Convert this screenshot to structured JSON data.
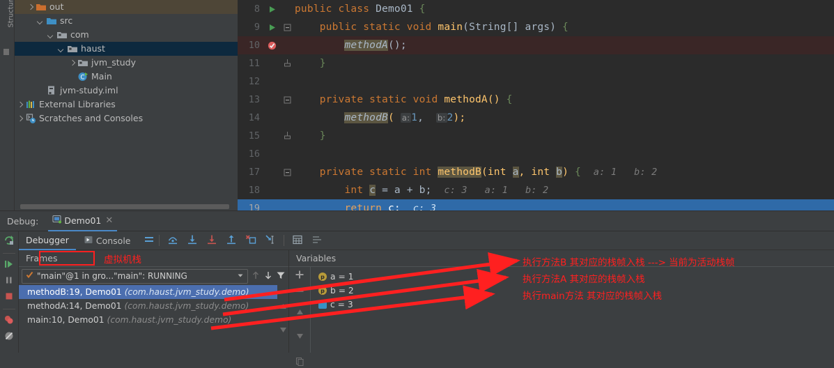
{
  "structure_tab": "Structure",
  "project_tree": {
    "items": [
      {
        "label": "out",
        "icon": "folder-orange-icon",
        "depth": 2,
        "arrow": "right",
        "state": "brown"
      },
      {
        "label": "src",
        "icon": "folder-blue-icon",
        "depth": 3,
        "arrow": "down",
        "state": "none"
      },
      {
        "label": "com",
        "icon": "package-icon",
        "depth": 4,
        "arrow": "down",
        "state": "none"
      },
      {
        "label": "haust",
        "icon": "package-icon",
        "depth": 5,
        "arrow": "down",
        "state": "selected"
      },
      {
        "label": "jvm_study",
        "icon": "package-icon",
        "depth": 6,
        "arrow": "right",
        "state": "none"
      },
      {
        "label": "Main",
        "icon": "java-class-run-icon",
        "depth": 6,
        "arrow": "none",
        "state": "none"
      },
      {
        "label": "jvm-study.iml",
        "icon": "iml-file-icon",
        "depth": 3,
        "arrow": "none",
        "state": "none"
      },
      {
        "label": "External Libraries",
        "icon": "libraries-icon",
        "depth": 1,
        "arrow": "right",
        "state": "none"
      },
      {
        "label": "Scratches and Consoles",
        "icon": "scratches-icon",
        "depth": 1,
        "arrow": "right",
        "state": "none"
      }
    ]
  },
  "editor": {
    "lines": [
      {
        "num": "8",
        "gutter": "run-green-icon",
        "fold": "none",
        "state": "normal"
      },
      {
        "num": "9",
        "gutter": "run-green-icon",
        "fold": "minus",
        "state": "normal"
      },
      {
        "num": "10",
        "gutter": "breakpoint-done-icon",
        "fold": "none",
        "state": "breakpoint"
      },
      {
        "num": "11",
        "gutter": "none",
        "fold": "end",
        "state": "normal"
      },
      {
        "num": "12",
        "gutter": "none",
        "fold": "none",
        "state": "normal"
      },
      {
        "num": "13",
        "gutter": "none",
        "fold": "minus",
        "state": "normal"
      },
      {
        "num": "14",
        "gutter": "none",
        "fold": "none",
        "state": "normal"
      },
      {
        "num": "15",
        "gutter": "none",
        "fold": "end",
        "state": "normal"
      },
      {
        "num": "16",
        "gutter": "none",
        "fold": "none",
        "state": "normal"
      },
      {
        "num": "17",
        "gutter": "none",
        "fold": "minus",
        "state": "normal"
      },
      {
        "num": "18",
        "gutter": "none",
        "fold": "none",
        "state": "normal"
      },
      {
        "num": "19",
        "gutter": "none",
        "fold": "none",
        "state": "current"
      }
    ],
    "code": {
      "l8": {
        "kw": "public class",
        "name": "Demo01",
        "brace": "{"
      },
      "l9": {
        "kw1": "public static void",
        "name": "main",
        "params": "(String[] args)",
        "brace": "{"
      },
      "l10": {
        "call": "methodA",
        "rest": "();"
      },
      "l11": {
        "brace": "}"
      },
      "l13": {
        "kw": "private static void",
        "name": "methodA()",
        "brace": "{"
      },
      "l14": {
        "call": "methodB",
        "open": "(",
        "hint_a": "a:",
        "val_a": "1",
        "comma": ",",
        "hint_b": "b:",
        "val_b": "2",
        "close": ");"
      },
      "l15": {
        "brace": "}"
      },
      "l17": {
        "kw": "private static int",
        "name": "methodB",
        "sig_open": "(int ",
        "pa": "a",
        "sig_mid": ", int ",
        "pb": "b",
        "sig_close": ")",
        "brace": "{",
        "hint": "a: 1   b: 2"
      },
      "l18": {
        "kw": "int",
        "var": "c",
        "expr": "= a + b;",
        "hint": "c: 3   a: 1   b: 2"
      },
      "l19": {
        "kw": "return",
        "var": "c;",
        "hint": "c: 3"
      }
    }
  },
  "debug_panel": {
    "label": "Debug:",
    "run_config": "Demo01",
    "close_icon": "close-icon",
    "tabs": [
      {
        "label": "Debugger",
        "icon": "none",
        "active": true
      },
      {
        "label": "Console",
        "icon": "console-icon",
        "active": false
      }
    ],
    "toolbar_icons": [
      "layout-icon",
      "step-over-icon",
      "step-into-icon",
      "force-step-into-icon",
      "step-out-icon",
      "drop-frame-icon",
      "run-to-cursor-icon",
      "evaluate-expression-icon",
      "settings-lines-icon"
    ],
    "left_icons": [
      "rerun-icon",
      "resume-icon",
      "pause-icon",
      "stop-icon",
      "view-breakpoints-icon",
      "mute-breakpoints-icon"
    ],
    "frames": {
      "header": "Frames",
      "thread": "\"main\"@1 in gro...\"main\": RUNNING",
      "thread_check_icon": "checkmark-icon",
      "dropdown_icon": "chevron-down-icon",
      "toolbar_icons": [
        "arrow-up-icon",
        "arrow-down-icon",
        "filter-icon"
      ],
      "rows": [
        {
          "method": "methodB:19, Demo01",
          "pkg": "(com.haust.jvm_study.demo)",
          "selected": true
        },
        {
          "method": "methodA:14, Demo01",
          "pkg": "(com.haust.jvm_study.demo)",
          "selected": false
        },
        {
          "method": "main:10, Demo01",
          "pkg": "(com.haust.jvm_study.demo)",
          "selected": false
        }
      ]
    },
    "variables": {
      "header": "Variables",
      "add_icon": "plus-icon",
      "gutter_icons": [
        "plus-icon",
        "minus-icon",
        "arrow-up-icon",
        "arrow-down-icon",
        "copy-icon"
      ],
      "rows": [
        {
          "badge": "p",
          "text": "a = 1",
          "type": "param"
        },
        {
          "badge": "p",
          "text": "b = 2",
          "type": "param"
        },
        {
          "badge": "",
          "text": "c = 3",
          "type": "local"
        }
      ]
    }
  },
  "annotations": {
    "frames_box_label": "Frames",
    "jvm_stack_note": "虚拟机栈",
    "lines": [
      "执行方法B 其对应的栈帧入栈  ---> 当前为活动栈帧",
      "执行方法A 其对应的栈帧入栈",
      "执行main方法 其对应的栈帧入栈"
    ],
    "color": "#ff2020"
  }
}
